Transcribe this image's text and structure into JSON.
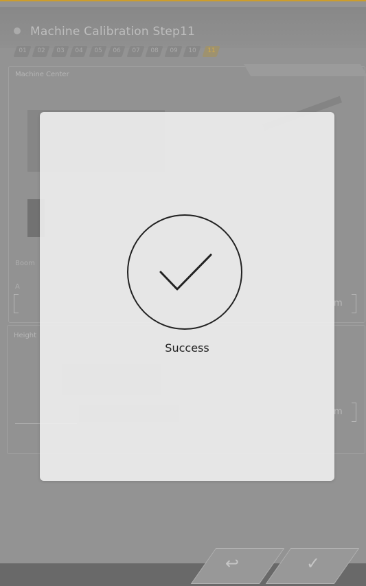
{
  "header": {
    "title": "Machine Calibration Step11",
    "steps": [
      "01",
      "02",
      "03",
      "04",
      "05",
      "06",
      "07",
      "08",
      "09",
      "10",
      "11"
    ],
    "active_step": "11"
  },
  "panels": {
    "machine_center": {
      "label": "Machine Center"
    },
    "boom": {
      "label": "Boom",
      "field_label": "A",
      "unit": "m"
    },
    "height": {
      "label": "Height",
      "unit": "m"
    }
  },
  "footer": {
    "back_icon": "return-arrow-icon",
    "confirm_icon": "checkmark-icon"
  },
  "modal": {
    "icon": "success-check-icon",
    "message": "Success"
  }
}
